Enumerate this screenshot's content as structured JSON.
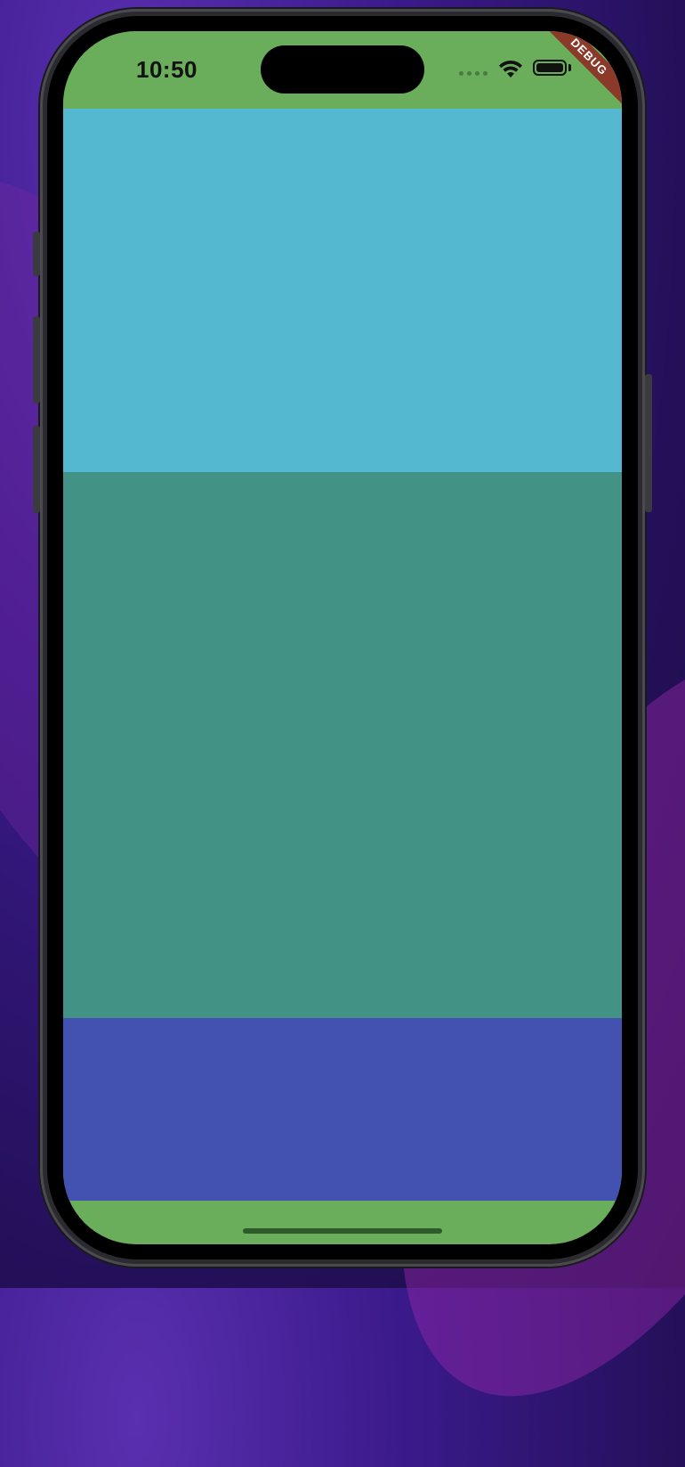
{
  "status_bar": {
    "time": "10:50",
    "wifi_icon": "wifi-icon",
    "battery_icon": "battery-icon",
    "signal_icon": "signal-dots-icon",
    "background_color": "#6aad5a"
  },
  "debug_banner": {
    "label": "DEBUG",
    "color": "#8b3a2a"
  },
  "content_blocks": [
    {
      "color": "#53b8d0"
    },
    {
      "color": "#439286"
    },
    {
      "color": "#4352b0"
    }
  ]
}
